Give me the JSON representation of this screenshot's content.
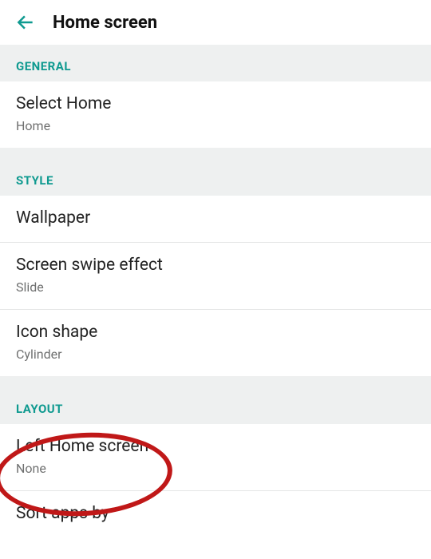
{
  "appbar": {
    "title": "Home screen"
  },
  "sections": {
    "general": {
      "header": "GENERAL",
      "select_home": {
        "title": "Select Home",
        "value": "Home"
      }
    },
    "style": {
      "header": "STYLE",
      "wallpaper": {
        "title": "Wallpaper"
      },
      "screen_swipe": {
        "title": "Screen swipe effect",
        "value": "Slide"
      },
      "icon_shape": {
        "title": "Icon shape",
        "value": "Cylinder"
      }
    },
    "layout": {
      "header": "LAYOUT",
      "left_home": {
        "title": "Left Home screen",
        "value": "None"
      },
      "sort_apps": {
        "title": "Sort apps by"
      }
    }
  }
}
